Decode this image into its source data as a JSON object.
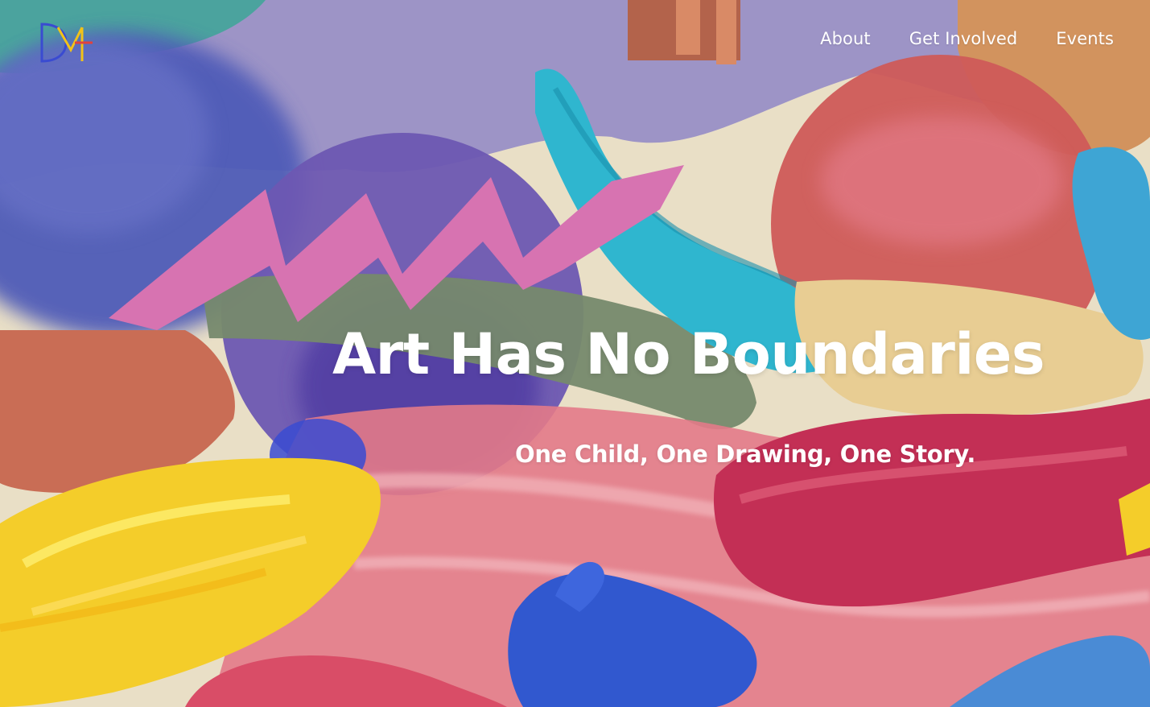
{
  "brand": {
    "logo_name": "logo-icon",
    "colors": [
      "#3a4bd1",
      "#f2c318",
      "#e0413e"
    ]
  },
  "nav": {
    "items": [
      {
        "label": "About"
      },
      {
        "label": "Get Involved"
      },
      {
        "label": "Events"
      }
    ]
  },
  "hero": {
    "headline": "Art Has No Boundaries",
    "tagline": "One Child, One Drawing, One Story.",
    "background": "abstract-paint-strokes-image",
    "palette": {
      "cream": "#e9dfc6",
      "lavender": "#9d94c6",
      "blue": "#4f5bb8",
      "pink": "#d773b1",
      "turquoise": "#2fb6cf",
      "coral": "#cf5a59",
      "yellow": "#f4cd2a",
      "rose": "#e37a88",
      "sand": "#e8cd93"
    }
  }
}
